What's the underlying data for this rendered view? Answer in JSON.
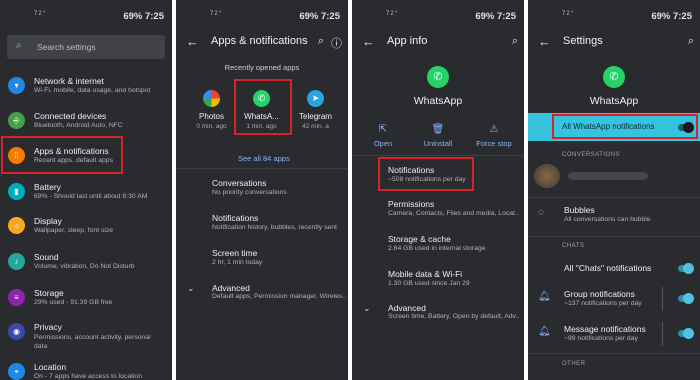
{
  "status": {
    "temp": "72°",
    "battery_time": "69% 7:25"
  },
  "p1": {
    "search_placeholder": "Search settings",
    "items": [
      {
        "title": "Network & internet",
        "sub": "Wi-Fi, mobile, data usage, and hotspot",
        "color": "#1e88e5",
        "icon": "wifi-icon"
      },
      {
        "title": "Connected devices",
        "sub": "Bluetooth, Android Auto, NFC",
        "color": "#43a047",
        "icon": "devices-icon"
      },
      {
        "title": "Apps & notifications",
        "sub": "Recent apps, default apps",
        "color": "#f57c00",
        "icon": "apps-icon"
      },
      {
        "title": "Battery",
        "sub": "69% - Should last until about 8:30 AM",
        "color": "#00acc1",
        "icon": "battery-icon"
      },
      {
        "title": "Display",
        "sub": "Wallpaper, sleep, font size",
        "color": "#f9a825",
        "icon": "display-icon"
      },
      {
        "title": "Sound",
        "sub": "Volume, vibration, Do Not Disturb",
        "color": "#26a69a",
        "icon": "sound-icon"
      },
      {
        "title": "Storage",
        "sub": "29% used - 91.39 GB free",
        "color": "#8e24aa",
        "icon": "storage-icon"
      },
      {
        "title": "Privacy",
        "sub": "Permissions, account activity, personal data",
        "color": "#3949ab",
        "icon": "privacy-icon"
      },
      {
        "title": "Location",
        "sub": "On - 7 apps have access to location",
        "color": "#1e88e5",
        "icon": "location-icon"
      }
    ]
  },
  "p2": {
    "title": "Apps & notifications",
    "recent_label": "Recently opened apps",
    "apps": [
      {
        "name": "Photos",
        "time": "0 min. ago"
      },
      {
        "name": "WhatsA...",
        "time": "1 min. ago"
      },
      {
        "name": "Telegram",
        "time": "42 min. a"
      }
    ],
    "see_all": "See all 84 apps",
    "items": [
      {
        "title": "Conversations",
        "sub": "No priority conversations"
      },
      {
        "title": "Notifications",
        "sub": "Notification history, bubbles, recently sent"
      },
      {
        "title": "Screen time",
        "sub": "2 hr, 1 min today"
      },
      {
        "title": "Advanced",
        "sub": "Default apps, Permission manager, Wireles.."
      }
    ]
  },
  "p3": {
    "title": "App info",
    "app_name": "WhatsApp",
    "actions": [
      "Open",
      "Uninstall",
      "Force stop"
    ],
    "items": [
      {
        "title": "Notifications",
        "sub": "~508 notifications per day"
      },
      {
        "title": "Permissions",
        "sub": "Camera, Contacts, Files and media, Locat.."
      },
      {
        "title": "Storage & cache",
        "sub": "2.64 GB used in internal storage"
      },
      {
        "title": "Mobile data & Wi-Fi",
        "sub": "1.30 GB used since Jan 29"
      },
      {
        "title": "Advanced",
        "sub": "Screen time, Battery, Open by default, Adv.."
      }
    ]
  },
  "p4": {
    "title": "Settings",
    "app_name": "WhatsApp",
    "all_notifications": "All WhatsApp notifications",
    "section_conversations": "CONVERSATIONS",
    "bubbles_title": "Bubbles",
    "bubbles_sub": "All conversations can bubble",
    "section_chats": "CHATS",
    "chats_title": "All \"Chats\" notifications",
    "group_title": "Group notifications",
    "group_sub": "~137 notifications per day",
    "message_title": "Message notifications",
    "message_sub": "~99 notifications per day",
    "section_other": "OTHER"
  },
  "colors": {
    "accent": "#8ab4f8",
    "highlight": "#36c3dd",
    "red": "#d6232a",
    "toggle": "#4dc3e0",
    "whatsapp": "#25d366"
  }
}
